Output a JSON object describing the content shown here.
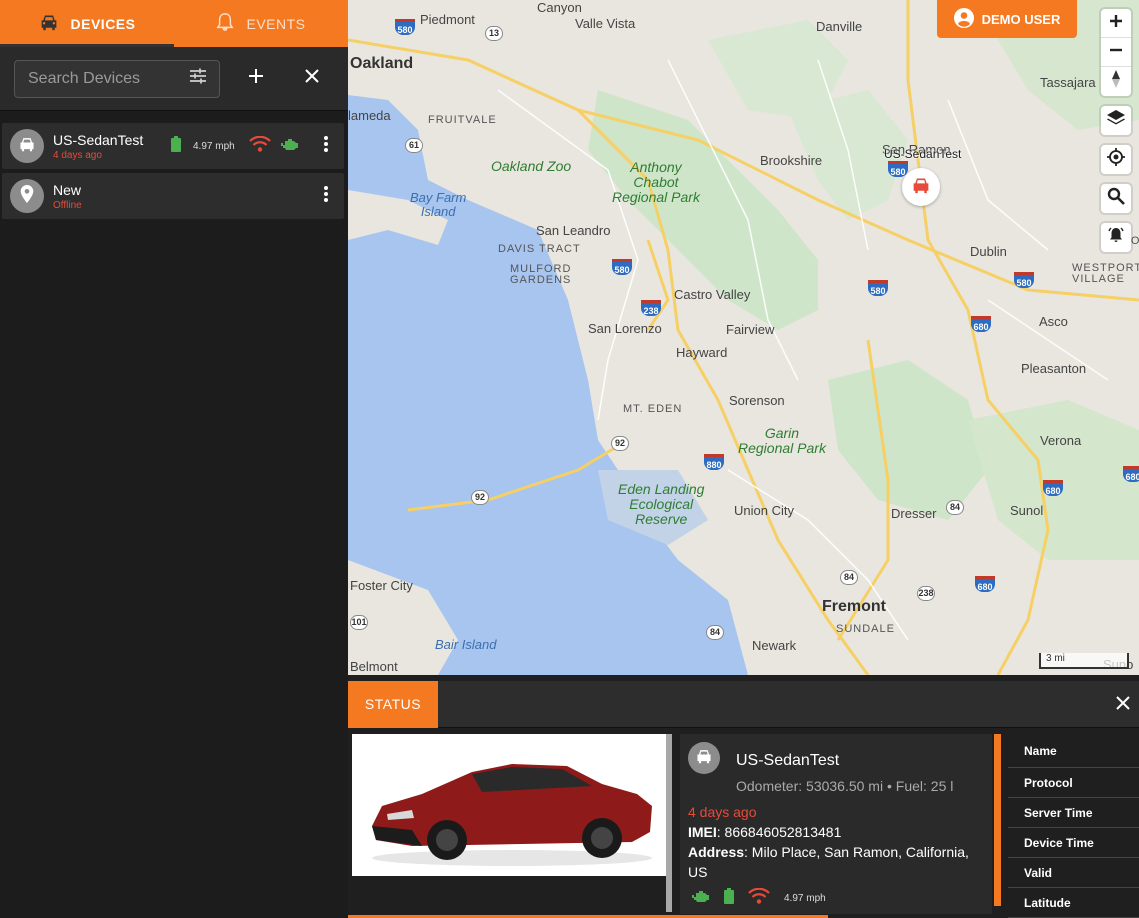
{
  "tabs": [
    {
      "label": "DEVICES",
      "icon": "car-icon",
      "active": true
    },
    {
      "label": "EVENTS",
      "icon": "bell-icon",
      "active": false
    }
  ],
  "search": {
    "placeholder": "Search Devices"
  },
  "devices": [
    {
      "name": "US-SedanTest",
      "status": "4 days ago",
      "speed": "4.97 mph",
      "icon": "car-icon"
    },
    {
      "name": "New",
      "status": "Offline",
      "icon": "location-pin-icon"
    }
  ],
  "demo_user": "DEMO USER",
  "map": {
    "marker_label": "US-SedanTest",
    "scale": "3 mi",
    "labels": {
      "piedmont": "Piedmont",
      "canyon": "Canyon",
      "valle_vista": "Valle Vista",
      "danville": "Danville",
      "oakland": "Oakland",
      "tassajara": "Tassajara",
      "alameda": "lameda",
      "fruitvale": "FRUITVALE",
      "san_ramon": "San Ramon",
      "oakland_zoo": "Oakland Zoo",
      "anthony_chabot": "Anthony\nChabot\nRegional Park",
      "brookshire": "Brookshire",
      "bay_farm": "Bay Farm\nIsland",
      "san_leandro": "San Leandro",
      "dublin": "Dublin",
      "davis_tract": "DAVIS TRACT",
      "mulford": "MULFORD\nGARDENS",
      "portola": "PORO",
      "westport": "WESTPORT\nVILLAGE",
      "castro_valley": "Castro Valley",
      "san_lorenzo": "San Lorenzo",
      "fairview": "Fairview",
      "asco": "Asco",
      "hayward": "Hayward",
      "pleasanton": "Pleasanton",
      "mt_eden": "MT. EDEN",
      "sorenson": "Sorenson",
      "garin": "Garin\nRegional Park",
      "verona": "Verona",
      "eden_landing": "Eden Landing\nEcological\nReserve",
      "union_city": "Union City",
      "dresser": "Dresser",
      "sunol": "Sunol",
      "foster_city": "Foster City",
      "fremont": "Fremont",
      "sundale": "SUNDALE",
      "bair_island": "Bair Island",
      "newark": "Newark",
      "belmont": "Belmont",
      "suno": "Suno"
    },
    "shields": {
      "i580_a": "580",
      "i580_b": "580",
      "i580_c": "580",
      "i580_d": "580",
      "i580_e": "580",
      "i580_f": "580",
      "i680_a": "680",
      "i680_b": "680",
      "i680_c": "680",
      "i680_d": "680",
      "i880": "880",
      "i238_a": "238",
      "i238_b": "238",
      "r13": "13",
      "r61": "61",
      "r92_a": "92",
      "r92_b": "92",
      "r84_a": "84",
      "r84_b": "84",
      "r84_c": "84",
      "r101": "101"
    }
  },
  "status_panel": {
    "tab_label": "STATUS",
    "device_name": "US-SedanTest",
    "odometer_line": "Odometer: 53036.50 mi • Fuel: 25 l",
    "ago": "4 days ago",
    "imei_label": "IMEI",
    "imei": ": 866846052813481",
    "address_label": "Address",
    "address": ": Milo Place, San Ramon, California, US",
    "speed": "4.97 mph",
    "attributes": [
      "Name",
      "Protocol",
      "Server Time",
      "Device Time",
      "Valid",
      "Latitude"
    ]
  },
  "colors": {
    "accent": "#f47920",
    "battery": "#4caf50",
    "signal": "#e84a3a",
    "engine": "#4caf50",
    "offline": "#e84a3a"
  }
}
